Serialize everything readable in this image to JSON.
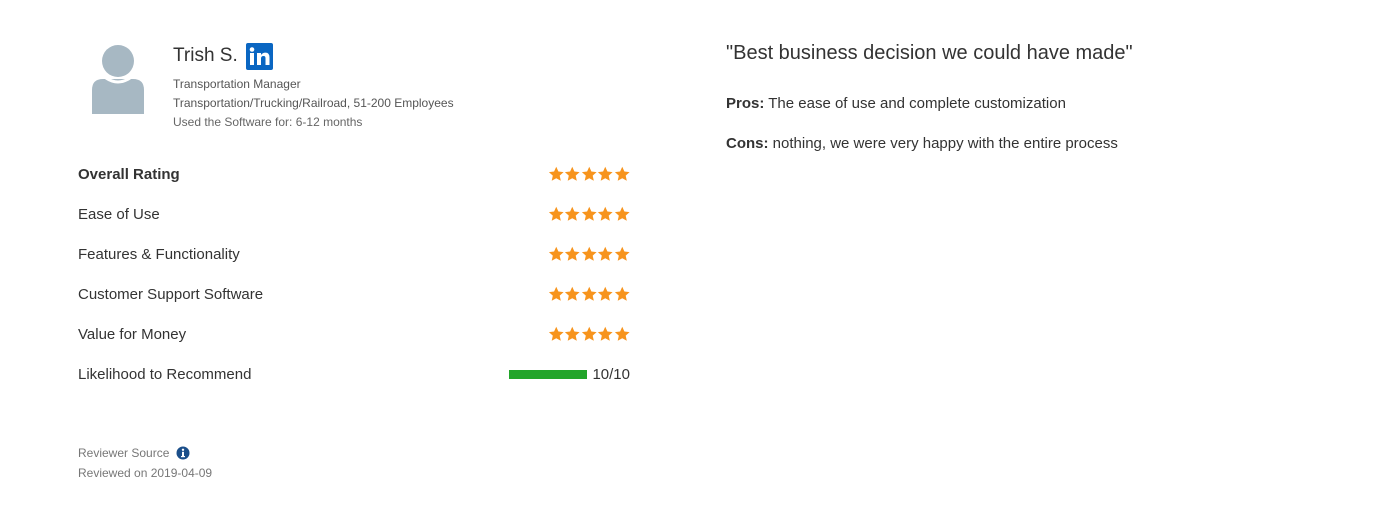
{
  "reviewer": {
    "name": "Trish S.",
    "title": "Transportation Manager",
    "company": "Transportation/Trucking/Railroad, 51-200 Employees",
    "usage": "Used the Software for: 6-12 months",
    "avatar_icon": "user-avatar-icon",
    "social_icon": "linkedin-icon"
  },
  "ratings": [
    {
      "label": "Overall Rating",
      "stars": 5,
      "max": 5
    },
    {
      "label": "Ease of Use",
      "stars": 5,
      "max": 5
    },
    {
      "label": "Features & Functionality",
      "stars": 5,
      "max": 5
    },
    {
      "label": "Customer Support Software",
      "stars": 5,
      "max": 5
    },
    {
      "label": "Value for Money",
      "stars": 5,
      "max": 5
    }
  ],
  "recommend": {
    "label": "Likelihood to Recommend",
    "value": 10,
    "max": 10,
    "text": "10/10"
  },
  "footer": {
    "source": "Reviewer Source",
    "reviewed": "Reviewed on 2019-04-09",
    "info_icon": "info-icon"
  },
  "review": {
    "title": "\"Best business decision we could have made\"",
    "pros_label": "Pros:",
    "pros_text": " The ease of use and complete customization",
    "cons_label": "Cons:",
    "cons_text": " nothing, we were very happy with the entire process"
  },
  "colors": {
    "star": "#f7941d",
    "recommend_bar": "#22a52a",
    "linkedin": "#0a66c2",
    "avatar": "#a7b8c3",
    "info": "#1b4f8a"
  }
}
